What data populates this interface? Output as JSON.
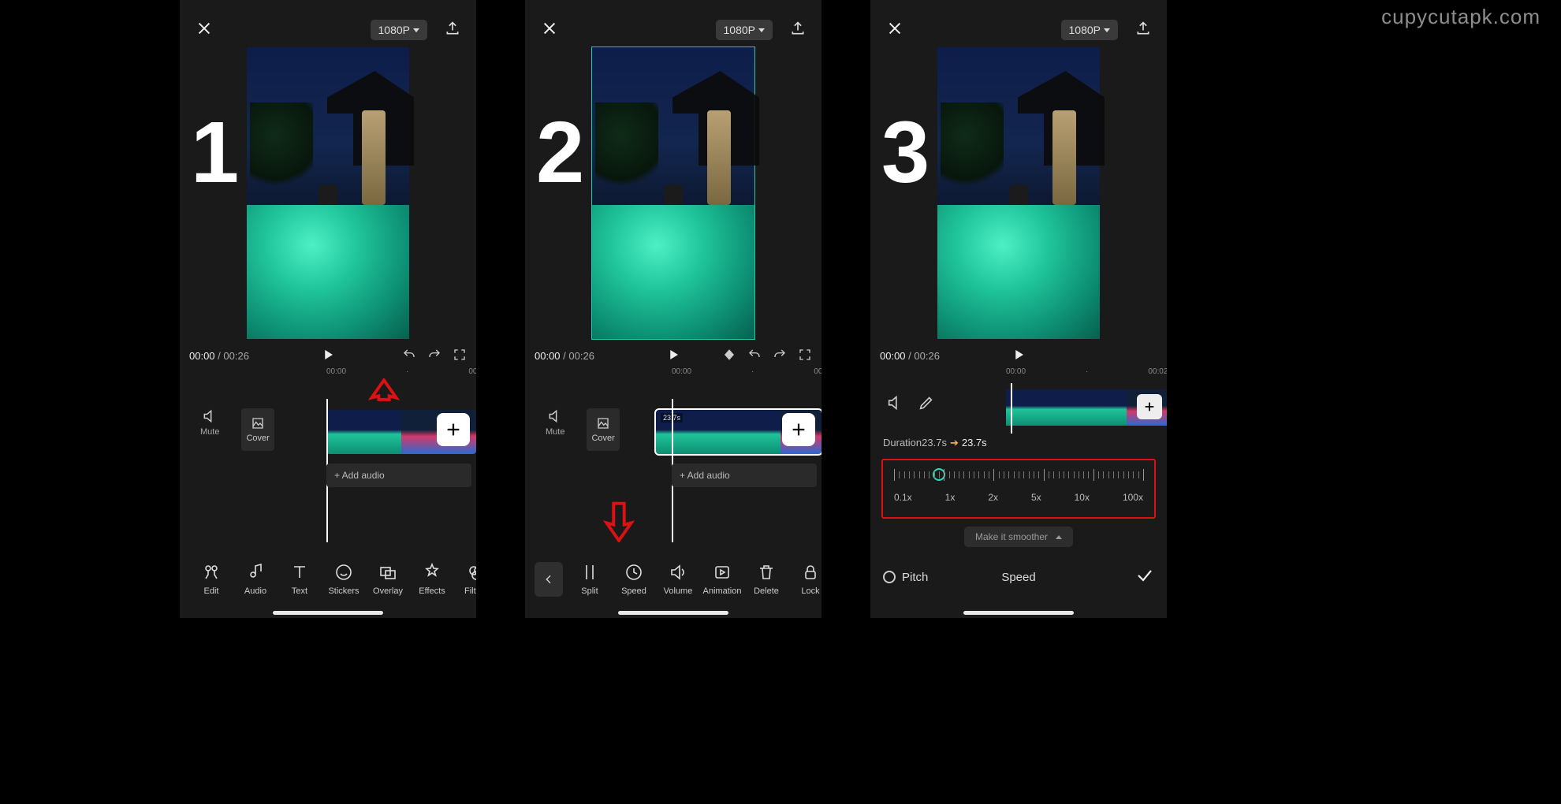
{
  "watermark": "cupycutapk.com",
  "panel_numbers": [
    "1",
    "2",
    "3"
  ],
  "topbar": {
    "resolution": "1080P"
  },
  "playback": {
    "current": "00:00",
    "total": "00:26"
  },
  "ruler": {
    "t0": "00:00",
    "t1": "00:02"
  },
  "timeline": {
    "mute_label": "Mute",
    "cover_label": "Cover",
    "add_audio": "+  Add audio",
    "clip_duration_badge": "23.7s"
  },
  "toolbar_main": [
    {
      "id": "edit",
      "label": "Edit"
    },
    {
      "id": "audio",
      "label": "Audio"
    },
    {
      "id": "text",
      "label": "Text"
    },
    {
      "id": "stickers",
      "label": "Stickers"
    },
    {
      "id": "overlay",
      "label": "Overlay"
    },
    {
      "id": "effects",
      "label": "Effects"
    },
    {
      "id": "filters",
      "label": "Filters"
    }
  ],
  "toolbar_clip": [
    {
      "id": "split",
      "label": "Split"
    },
    {
      "id": "speed",
      "label": "Speed"
    },
    {
      "id": "volume",
      "label": "Volume"
    },
    {
      "id": "animation",
      "label": "Animation"
    },
    {
      "id": "delete",
      "label": "Delete"
    },
    {
      "id": "lock",
      "label": "Lock"
    }
  ],
  "speed_panel": {
    "duration_label": "Duration",
    "duration_from": "23.7s",
    "duration_to": "23.7s",
    "marks": [
      "0.1x",
      "1x",
      "2x",
      "5x",
      "10x",
      "100x"
    ],
    "knob_pct": 18,
    "smoother_label": "Make it smoother",
    "pitch_label": "Pitch",
    "title": "Speed"
  }
}
